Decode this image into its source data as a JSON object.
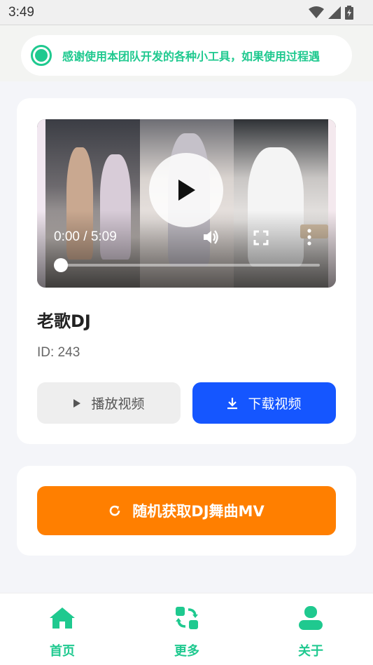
{
  "status_bar": {
    "time": "3:49",
    "icons": [
      "wifi-icon",
      "signal-icon",
      "battery-icon"
    ]
  },
  "notice": {
    "text": "感谢使用本团队开发的各种小工具，如果使用过程遇",
    "color": "#1fc98f"
  },
  "video_card": {
    "player": {
      "time": "0:00 / 5:09",
      "progress": 0.0
    },
    "title": "老歌DJ",
    "id_text": "ID: 243",
    "play_label": "播放视频",
    "download_label": "下载视频"
  },
  "random_card": {
    "button_label": "随机获取DJ舞曲MV",
    "color": "#ff7f00"
  },
  "bottom_nav": {
    "items": [
      {
        "label": "首页",
        "icon": "home-icon"
      },
      {
        "label": "更多",
        "icon": "refresh-grid-icon"
      },
      {
        "label": "关于",
        "icon": "user-icon"
      }
    ],
    "active_color": "#1fc98f"
  },
  "colors": {
    "primary_blue": "#1556ff",
    "accent_green": "#1fc98f",
    "accent_orange": "#ff7f00"
  }
}
